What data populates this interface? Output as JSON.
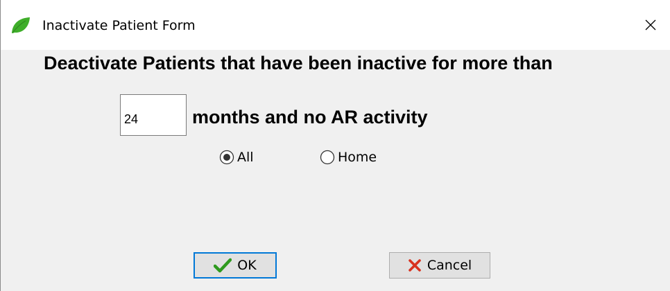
{
  "window": {
    "title": "Inactivate Patient Form",
    "app_icon": "leaf-icon",
    "close_icon": "close-icon"
  },
  "form": {
    "heading": "Deactivate Patients that have been inactive for more than",
    "months_value": "24",
    "months_suffix": "months and no AR activity",
    "radio_all_label": "All",
    "radio_home_label": "Home",
    "selected_option": "All"
  },
  "buttons": {
    "ok_label": "OK",
    "ok_icon": "checkmark-icon",
    "cancel_label": "Cancel",
    "cancel_icon": "x-icon"
  },
  "colors": {
    "leaf": "#3fae2a",
    "checkmark": "#2e9a1e",
    "cancel_x": "#d8321f",
    "focus_border": "#0078d7"
  }
}
